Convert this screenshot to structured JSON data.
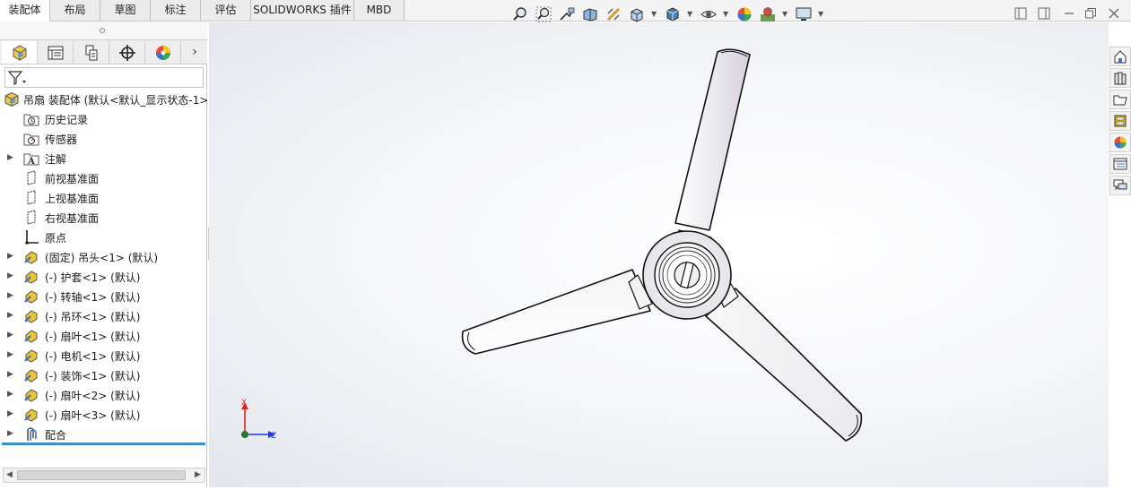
{
  "cm_tabs": [
    {
      "label": "装配体",
      "active": true
    },
    {
      "label": "布局",
      "active": false
    },
    {
      "label": "草图",
      "active": false
    },
    {
      "label": "标注",
      "active": false
    },
    {
      "label": "评估",
      "active": false
    },
    {
      "label": "SOLIDWORKS 插件",
      "active": false
    },
    {
      "label": "MBD",
      "active": false
    }
  ],
  "heads_up_icons": [
    "zoom-to-fit-icon",
    "zoom-to-area-icon",
    "previous-view-icon",
    "section-view-icon",
    "dynamic-annotation-icon",
    "view-orientation-icon",
    "display-style-icon",
    "hide-show-items-icon",
    "edit-appearance-icon",
    "apply-scene-icon",
    "view-settings-icon"
  ],
  "manager_tabs": [
    "featuremanager-tab",
    "propertymanager-tab",
    "configurationmanager-tab",
    "dimxpertmanager-tab",
    "displaymanager-tab"
  ],
  "tree": {
    "root": "吊扇 装配体 (默认<默认_显示状态-1>)",
    "items": [
      {
        "label": "历史记录",
        "icon": "history-folder-icon",
        "expandable": false
      },
      {
        "label": "传感器",
        "icon": "sensor-icon",
        "expandable": false
      },
      {
        "label": "注解",
        "icon": "annotations-icon",
        "expandable": true
      },
      {
        "label": "前视基准面",
        "icon": "plane-icon",
        "expandable": false
      },
      {
        "label": "上视基准面",
        "icon": "plane-icon",
        "expandable": false
      },
      {
        "label": "右视基准面",
        "icon": "plane-icon",
        "expandable": false
      },
      {
        "label": "原点",
        "icon": "origin-icon",
        "expandable": false
      },
      {
        "label": "(固定) 吊头<1> (默认)",
        "icon": "part-icon",
        "expandable": true
      },
      {
        "label": "(-) 护套<1> (默认)",
        "icon": "part-icon",
        "expandable": true
      },
      {
        "label": "(-) 转轴<1> (默认)",
        "icon": "part-icon",
        "expandable": true
      },
      {
        "label": "(-) 吊环<1> (默认)",
        "icon": "part-icon",
        "expandable": true
      },
      {
        "label": "(-) 扇叶<1> (默认)",
        "icon": "part-icon",
        "expandable": true
      },
      {
        "label": "(-) 电机<1> (默认)",
        "icon": "part-icon",
        "expandable": true
      },
      {
        "label": "(-) 装饰<1> (默认)",
        "icon": "part-icon",
        "expandable": true
      },
      {
        "label": "(-) 扇叶<2> (默认)",
        "icon": "part-icon",
        "expandable": true
      },
      {
        "label": "(-) 扇叶<3> (默认)",
        "icon": "part-icon",
        "expandable": true
      },
      {
        "label": "配合",
        "icon": "mates-icon",
        "expandable": true
      }
    ]
  },
  "triad": {
    "x_label": "X",
    "z_label": "Z"
  },
  "task_pane_icons": [
    "solidworks-resources-icon",
    "design-library-icon",
    "file-explorer-icon",
    "view-palette-icon",
    "appearances-scenes-icon",
    "custom-properties-icon",
    "forum-icon"
  ],
  "colors": {
    "accent": "#3a8fd0",
    "rollback_bar": "#3a8fd0",
    "part_yellow": "#e8c53a"
  }
}
